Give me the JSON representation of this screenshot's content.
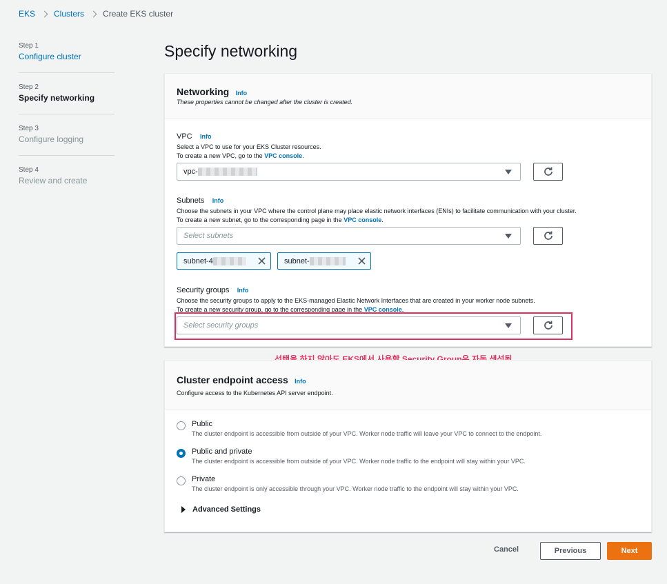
{
  "breadcrumb": {
    "items": [
      "EKS",
      "Clusters"
    ],
    "current": "Create EKS cluster"
  },
  "steps": [
    {
      "num": "Step 1",
      "title": "Configure cluster"
    },
    {
      "num": "Step 2",
      "title": "Specify networking"
    },
    {
      "num": "Step 3",
      "title": "Configure logging"
    },
    {
      "num": "Step 4",
      "title": "Review and create"
    }
  ],
  "page_title": "Specify networking",
  "networking": {
    "title": "Networking",
    "info": "Info",
    "desc": "These properties cannot be changed after the cluster is created.",
    "vpc": {
      "label": "VPC",
      "info": "Info",
      "desc1": "Select a VPC to use for your EKS Cluster resources.",
      "desc2_prefix": "To create a new VPC, go to the",
      "desc2_link": "VPC console",
      "desc2_suffix": ".",
      "value_prefix": "vpc-"
    },
    "subnets": {
      "label": "Subnets",
      "info": "Info",
      "desc1": "Choose the subnets in your VPC where the control plane may place elastic network interfaces (ENIs) to facilitate communication with your cluster.",
      "desc2_prefix": "To create a new subnet, go to the corresponding page in the",
      "desc2_link": "VPC console",
      "desc2_suffix": ".",
      "placeholder": "Select subnets",
      "tokens": [
        "subnet-4",
        "subnet-"
      ]
    },
    "security_groups": {
      "label": "Security groups",
      "info": "Info",
      "desc1": "Choose the security groups to apply to the EKS-managed Elastic Network Interfaces that are created in your worker node subnets.",
      "desc2_prefix": "To create a new security group, go to the corresponding page in the",
      "desc2_link": "VPC console",
      "desc2_suffix": ".",
      "placeholder": "Select security groups"
    }
  },
  "annotation": "선택을 하지 않아도 EKS에서 사용할 Security Group은 자동 생성됨",
  "endpoint": {
    "title": "Cluster endpoint access",
    "info": "Info",
    "desc": "Configure access to the Kubernetes API server endpoint.",
    "options": [
      {
        "label": "Public",
        "desc": "The cluster endpoint is accessible from outside of your VPC. Worker node traffic will leave your VPC to connect to the endpoint.",
        "checked": false
      },
      {
        "label": "Public and private",
        "desc": "The cluster endpoint is accessible from outside of your VPC. Worker node traffic to the endpoint will stay within your VPC.",
        "checked": true
      },
      {
        "label": "Private",
        "desc": "The cluster endpoint is only accessible through your VPC. Worker node traffic to the endpoint will stay within your VPC.",
        "checked": false
      }
    ],
    "advanced": "Advanced Settings"
  },
  "footer": {
    "cancel": "Cancel",
    "previous": "Previous",
    "next": "Next"
  }
}
